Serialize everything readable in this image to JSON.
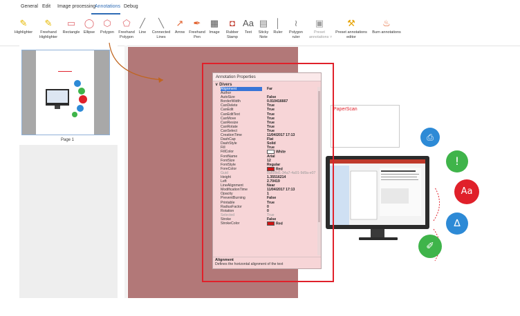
{
  "menu": {
    "tabs": [
      "General",
      "Edit",
      "Image processing",
      "Annotations",
      "Debug"
    ],
    "active": "Annotations"
  },
  "ribbon": {
    "tools": [
      {
        "label": "Highlighter",
        "icon": "highlighter-icon",
        "color": "#e7b900"
      },
      {
        "label": "Freehand\nHighlighter",
        "icon": "freehand-highlighter-icon",
        "color": "#e7b900"
      },
      {
        "label": "Rectangle",
        "icon": "rectangle-icon",
        "color": "#e0686e"
      },
      {
        "label": "Ellipse",
        "icon": "ellipse-icon",
        "color": "#e0686e"
      },
      {
        "label": "Polygon",
        "icon": "polygon-icon",
        "color": "#e0686e"
      },
      {
        "label": "Freehand\nPolygon",
        "icon": "freehand-polygon-icon",
        "color": "#e0686e"
      },
      {
        "label": "Line",
        "icon": "line-icon",
        "color": "#7a7a7a"
      },
      {
        "label": "Connected\nLines",
        "icon": "connected-lines-icon",
        "color": "#7a7a7a"
      },
      {
        "label": "Arrow",
        "icon": "arrow-icon",
        "color": "#e25f2b"
      },
      {
        "label": "Freehand\nPen",
        "icon": "freehand-pen-icon",
        "color": "#e25f2b"
      },
      {
        "label": "Image",
        "icon": "image-icon",
        "color": "#555555"
      },
      {
        "label": "Rubber\nStamp",
        "icon": "rubber-stamp-icon",
        "color": "#c0392b"
      },
      {
        "label": "Text",
        "icon": "text-icon",
        "color": "#555555"
      },
      {
        "label": "Sticky\nNote",
        "icon": "sticky-note-icon",
        "color": "#7a7a7a"
      },
      {
        "label": "Ruler",
        "icon": "ruler-icon",
        "color": "#7a7a7a"
      },
      {
        "label": "Polygon\nruler",
        "icon": "polygon-ruler-icon",
        "color": "#7a7a7a"
      },
      {
        "label": "Preset\nannotations ˅",
        "icon": "preset-annotations-icon",
        "color": "#a0a0a0"
      },
      {
        "label": "Preset annotations\neditor",
        "icon": "preset-editor-icon",
        "color": "#e7a300"
      },
      {
        "label": "Burn annotations",
        "icon": "burn-annotations-icon",
        "color": "#e25f2b"
      }
    ]
  },
  "thumbnails": {
    "page_label": "Page 1"
  },
  "properties": {
    "title": "Annotation Properties",
    "category": "Divers",
    "rows": [
      {
        "name": "Alignment",
        "value": "Far",
        "selected": true
      },
      {
        "name": "Author",
        "value": ""
      },
      {
        "name": "AutoSize",
        "value": "False"
      },
      {
        "name": "BorderWidth",
        "value": "0.010416667"
      },
      {
        "name": "CanDelete",
        "value": "True"
      },
      {
        "name": "CanEdit",
        "value": "True"
      },
      {
        "name": "CanEditText",
        "value": "True"
      },
      {
        "name": "CanMove",
        "value": "True"
      },
      {
        "name": "CanResize",
        "value": "True"
      },
      {
        "name": "CanRotate",
        "value": "True"
      },
      {
        "name": "CanSelect",
        "value": "True"
      },
      {
        "name": "CreationTime",
        "value": "11/04/2017 17:13"
      },
      {
        "name": "DashCap",
        "value": "Flat"
      },
      {
        "name": "DashStyle",
        "value": "Solid"
      },
      {
        "name": "Fill",
        "value": "True"
      },
      {
        "name": "FillColor",
        "value": "White",
        "swatch": "#ffffff"
      },
      {
        "name": "FontName",
        "value": "Arial"
      },
      {
        "name": "FontSize",
        "value": "12"
      },
      {
        "name": "FontStyle",
        "value": "Regular"
      },
      {
        "name": "ForeColor",
        "value": "Red",
        "swatch": "#d01313"
      },
      {
        "name": "Guid",
        "value": "8a609d1-34a7-4a91-9d9a-e07",
        "dim": true
      },
      {
        "name": "Height",
        "value": "1.35516214"
      },
      {
        "name": "Left",
        "value": "2.70419"
      },
      {
        "name": "LineAlignment",
        "value": "Near"
      },
      {
        "name": "ModificationTime",
        "value": "11/04/2017 17:13"
      },
      {
        "name": "Opacity",
        "value": "1"
      },
      {
        "name": "PreventBurning",
        "value": "False"
      },
      {
        "name": "Printable",
        "value": "True"
      },
      {
        "name": "RadiusFactor",
        "value": "0"
      },
      {
        "name": "Rotation",
        "value": "0"
      },
      {
        "name": "Selected",
        "value": "True",
        "dim": true
      },
      {
        "name": "Stroke",
        "value": "False"
      },
      {
        "name": "StrokeColor",
        "value": "Red",
        "swatch": "#d01313"
      }
    ],
    "desc_title": "Alignment",
    "desc_text": "Defines the horizontal alignment of the text"
  },
  "document": {
    "text_annotation": "PaperScan",
    "text_icon": "Aa"
  },
  "colors": {
    "accent": "#2d6bb5",
    "annotation_red": "#e0202a",
    "maroon": "#b27878"
  }
}
